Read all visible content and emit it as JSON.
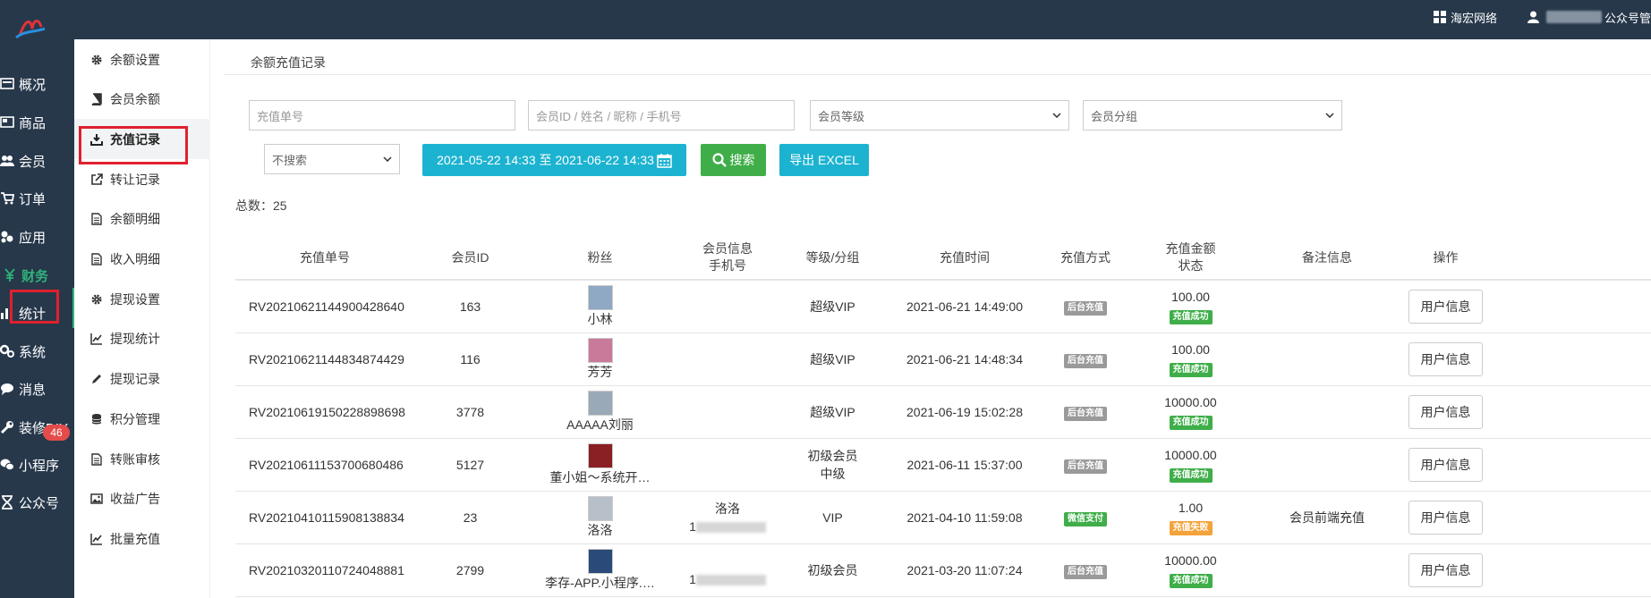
{
  "header": {
    "site_label": "海宏网络",
    "user_suffix": "公众号管"
  },
  "nav": [
    {
      "label": "概况",
      "icon": "dashboard-icon"
    },
    {
      "label": "商品",
      "icon": "goods-icon"
    },
    {
      "label": "会员",
      "icon": "users-icon"
    },
    {
      "label": "订单",
      "icon": "cart-icon"
    },
    {
      "label": "应用",
      "icon": "apps-icon"
    },
    {
      "label": "财务",
      "icon": "yen-icon"
    },
    {
      "label": "统计",
      "icon": "bar-chart-icon"
    },
    {
      "label": "系统",
      "icon": "gears-icon"
    },
    {
      "label": "消息",
      "icon": "chat-icon"
    },
    {
      "label": "装修DIY",
      "icon": "wrench-icon"
    },
    {
      "label": "小程序",
      "icon": "wechat-icon"
    },
    {
      "label": "公众号",
      "icon": "hourglass-icon"
    }
  ],
  "message_badge": "46",
  "subnav": [
    {
      "label": "余额设置",
      "icon": "gear-icon"
    },
    {
      "label": "会员余额",
      "icon": "book-icon"
    },
    {
      "label": "充值记录",
      "icon": "download-icon"
    },
    {
      "label": "转让记录",
      "icon": "external-link-icon"
    },
    {
      "label": "余额明细",
      "icon": "file-icon"
    },
    {
      "label": "收入明细",
      "icon": "file-icon"
    },
    {
      "label": "提现设置",
      "icon": "gear-icon"
    },
    {
      "label": "提现统计",
      "icon": "line-chart-icon"
    },
    {
      "label": "提现记录",
      "icon": "pencil-icon"
    },
    {
      "label": "积分管理",
      "icon": "database-icon"
    },
    {
      "label": "转账审核",
      "icon": "file-icon"
    },
    {
      "label": "收益广告",
      "icon": "image-icon"
    },
    {
      "label": "批量充值",
      "icon": "line-chart-icon"
    }
  ],
  "page": {
    "title": "余额充值记录",
    "total_label": "总数：25"
  },
  "filters": {
    "order_placeholder": "充值单号",
    "member_placeholder": "会员ID / 姓名 / 昵称 / 手机号",
    "level_select": "会员等级",
    "group_select": "会员分组",
    "time_select": "不搜索",
    "date_range": "2021-05-22 14:33 至 2021-06-22 14:33",
    "search_label": "搜索",
    "export_label": "导出 EXCEL"
  },
  "table": {
    "headers": {
      "order": "充值单号",
      "member_id": "会员ID",
      "fan": "粉丝",
      "member_info": "会员信息",
      "member_phone": "手机号",
      "level": "等级/分组",
      "time": "充值时间",
      "method": "充值方式",
      "amount": "充值金额",
      "status": "状态",
      "remark": "备注信息",
      "action": "操作"
    },
    "rows": [
      {
        "order": "RV20210621144900428640",
        "member_id": "163",
        "fan": "小林",
        "info_name": "",
        "info_phone": "",
        "level": "超级VIP",
        "group": "",
        "time": "2021-06-21 14:49:00",
        "method": "后台充值",
        "amount": "100.00",
        "status": "充值成功",
        "remark": "",
        "action": "用户信息"
      },
      {
        "order": "RV20210621144834874429",
        "member_id": "116",
        "fan": "芳芳",
        "info_name": "",
        "info_phone": "",
        "level": "超级VIP",
        "group": "",
        "time": "2021-06-21 14:48:34",
        "method": "后台充值",
        "amount": "100.00",
        "status": "充值成功",
        "remark": "",
        "action": "用户信息"
      },
      {
        "order": "RV20210619150228898698",
        "member_id": "3778",
        "fan": "AAAAA刘丽",
        "info_name": "",
        "info_phone": "",
        "level": "超级VIP",
        "group": "",
        "time": "2021-06-19 15:02:28",
        "method": "后台充值",
        "amount": "10000.00",
        "status": "充值成功",
        "remark": "",
        "action": "用户信息"
      },
      {
        "order": "RV20210611153700680486",
        "member_id": "5127",
        "fan": "董小姐～系统开…",
        "info_name": "",
        "info_phone": "",
        "level": "初级会员",
        "group": "中级",
        "time": "2021-06-11 15:37:00",
        "method": "后台充值",
        "amount": "10000.00",
        "status": "充值成功",
        "remark": "",
        "action": "用户信息"
      },
      {
        "order": "RV20210410115908138834",
        "member_id": "23",
        "fan": "洛洛",
        "info_name": "洛洛",
        "info_phone": "1",
        "level": "VIP",
        "group": "",
        "time": "2021-04-10 11:59:08",
        "method": "微信支付",
        "amount": "1.00",
        "status": "充值失败",
        "remark": "会员前端充值",
        "action": "用户信息"
      },
      {
        "order": "RV20210320110724048881",
        "member_id": "2799",
        "fan": "李存-APP.小程序.…",
        "info_name": "",
        "info_phone": "1",
        "level": "初级会员",
        "group": "",
        "time": "2021-03-20 11:07:24",
        "method": "后台充值",
        "amount": "10000.00",
        "status": "充值成功",
        "remark": "",
        "action": "用户信息"
      }
    ]
  }
}
